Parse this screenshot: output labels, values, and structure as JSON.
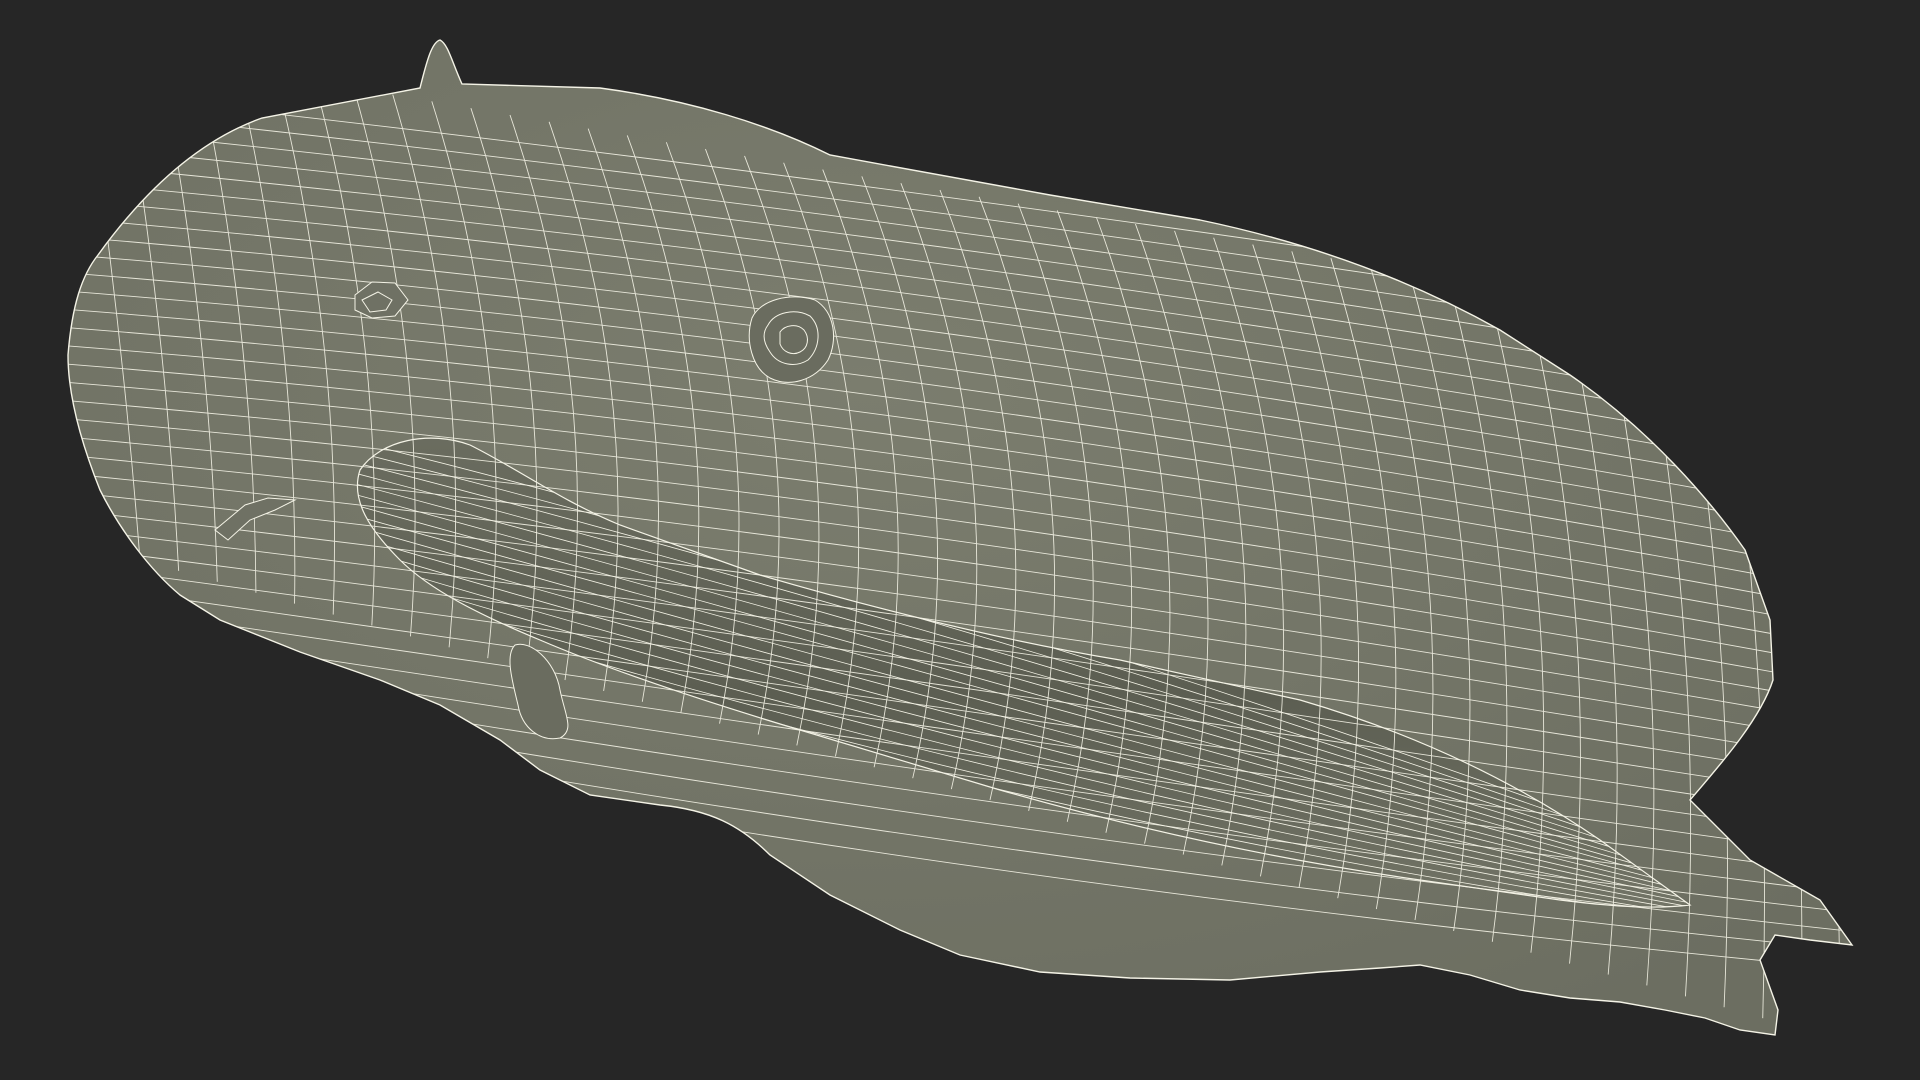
{
  "viewport": {
    "background_color": "#262626",
    "subject": "wireframe-3d-model",
    "mesh_fill_color": "#767868",
    "mesh_shadow_color": "#5c5e52",
    "wire_color": "#f4f3e6"
  }
}
